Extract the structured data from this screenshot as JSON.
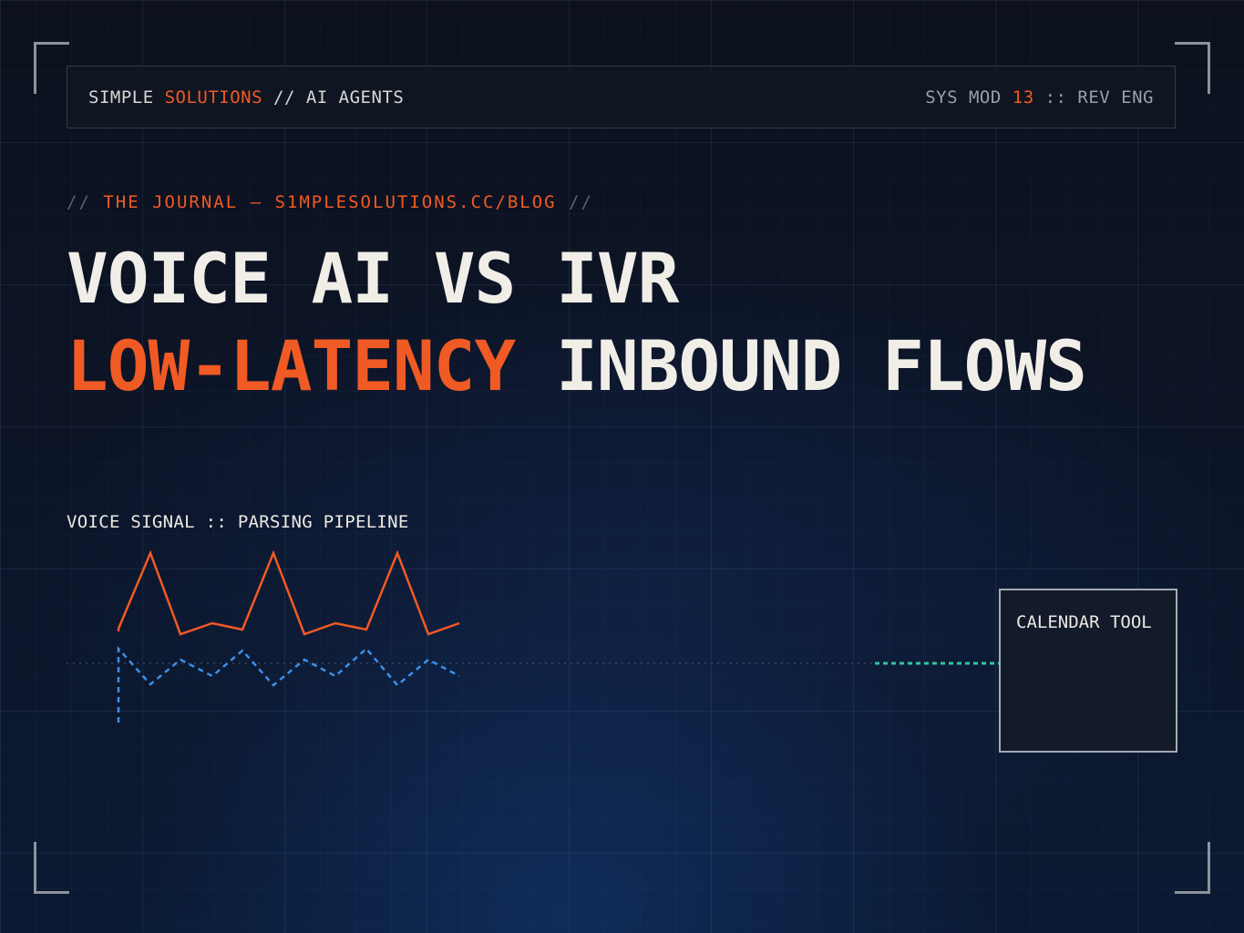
{
  "header": {
    "brand_a": "SIMPLE",
    "brand_b": "SOLUTIONS",
    "brand_c": "// AI AGENTS",
    "sys_a": "SYS MOD",
    "sys_b": "13",
    "sys_c": ":: REV ENG"
  },
  "kicker": {
    "slash_open": "//",
    "text": "THE JOURNAL — S1MPLESOLUTIONS.CC/BLOG",
    "slash_close": "//"
  },
  "headline": {
    "line1": "VOICE AI VS IVR",
    "line2_accent": "LOW-LATENCY",
    "line2_rest": "INBOUND FLOWS"
  },
  "signal": {
    "label": "VOICE SIGNAL :: PARSING PIPELINE"
  },
  "tool": {
    "label": "CALENDAR TOOL"
  },
  "colors": {
    "accent": "#f05a24",
    "signal_secondary": "#3d8fe8",
    "connector": "#2fc6a0",
    "text": "#f1eee8"
  }
}
